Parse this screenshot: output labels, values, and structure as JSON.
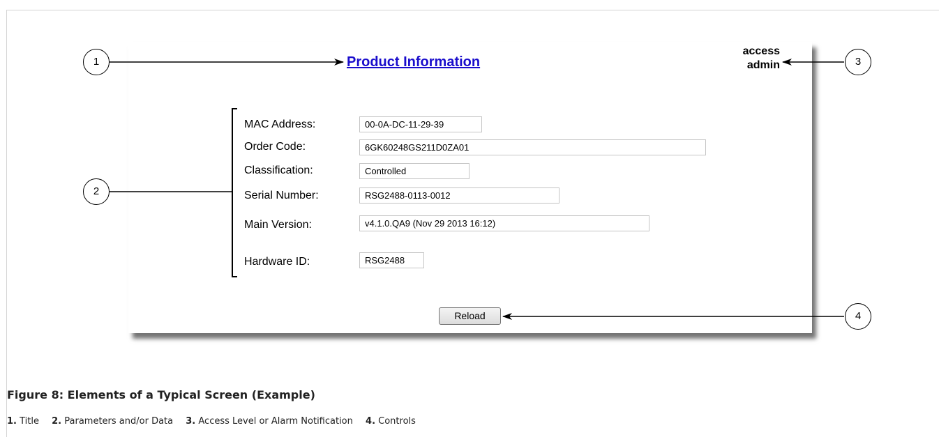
{
  "screen": {
    "title": "Product Information",
    "access_line1": "access",
    "access_line2": "admin",
    "fields": [
      {
        "label": "MAC Address:",
        "value": "00-0A-DC-11-29-39"
      },
      {
        "label": "Order Code:",
        "value": "6GK60248GS211D0ZA01"
      },
      {
        "label": "Classification:",
        "value": "Controlled"
      },
      {
        "label": "Serial Number:",
        "value": "RSG2488-0113-0012"
      },
      {
        "label": "Main Version:",
        "value": "v4.1.0.QA9 (Nov 29 2013 16:12)"
      },
      {
        "label": "Hardware ID:",
        "value": "RSG2488"
      }
    ],
    "reload_label": "Reload"
  },
  "callouts": [
    "1",
    "2",
    "3",
    "4"
  ],
  "figure": {
    "caption": "Figure 8: Elements of a Typical Screen (Example)",
    "legend": [
      {
        "num": "1.",
        "text": "Title"
      },
      {
        "num": "2.",
        "text": "Parameters and/or Data"
      },
      {
        "num": "3.",
        "text": "Access Level or Alarm Notification"
      },
      {
        "num": "4.",
        "text": "Controls"
      }
    ]
  }
}
